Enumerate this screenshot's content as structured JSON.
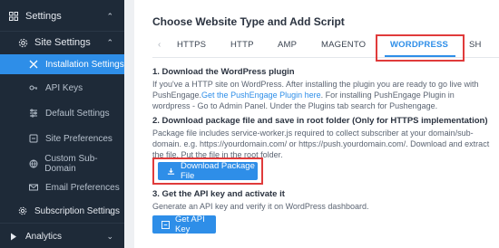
{
  "sidebar": {
    "settings_label": "Settings",
    "site_settings_label": "Site Settings",
    "items": [
      {
        "label": "Installation Settings"
      },
      {
        "label": "API Keys"
      },
      {
        "label": "Default Settings"
      },
      {
        "label": "Site Preferences"
      },
      {
        "label": "Custom Sub-Domain"
      },
      {
        "label": "Email Preferences"
      }
    ],
    "subscription_settings_label": "Subscription Settings",
    "analytics_label": "Analytics"
  },
  "main": {
    "title": "Choose Website Type and Add Script",
    "tabs": [
      "HTTPS",
      "HTTP",
      "AMP",
      "MAGENTO",
      "WORDPRESS",
      "SH"
    ],
    "active_tab": "WORDPRESS",
    "step1": {
      "title": "1. Download the WordPress plugin",
      "text_pre": "If you've a HTTP site on WordPress. After installing the plugin you are ready to go live with PushEngage.",
      "link": "Get the PushEngage Plugin here",
      "text_post": ". For installing PushEngage Plugin in wordpress - Go to Admin Panel. Under the Plugins tab search for Pushengage."
    },
    "step2": {
      "title": "2. Download package file and save in root folder (Only for HTTPS implementation)",
      "text": "Package file includes service-worker.js required to collect subscriber at your domain/sub-domain. e.g. https://yourdomain.com/ or https://push.yourdomain.com/. Download and extract the file. Put the file in the root folder.",
      "button_label": "Download Package File"
    },
    "step3": {
      "title": "3. Get the API key and activate it",
      "text": "Generate an API key and verify it on WordPress dashboard.",
      "button_label": "Get API Key"
    }
  },
  "colors": {
    "accent": "#2e8ee8",
    "sidebar_bg": "#1e2a38",
    "highlight_box": "#e03b3b"
  }
}
